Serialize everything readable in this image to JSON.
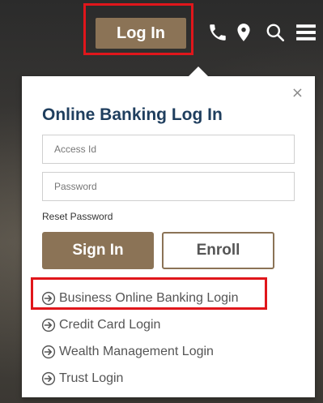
{
  "header": {
    "login_label": "Log In",
    "icons": [
      "phone-icon",
      "map-pin-icon",
      "search-icon",
      "menu-icon"
    ]
  },
  "login_panel": {
    "title": "Online Banking Log In",
    "close_symbol": "×",
    "access_id_placeholder": "Access Id",
    "password_placeholder": "Password",
    "reset_password_label": "Reset Password",
    "sign_in_label": "Sign In",
    "enroll_label": "Enroll",
    "links": [
      {
        "label": "Business Online Banking Login"
      },
      {
        "label": "Credit Card Login"
      },
      {
        "label": "Wealth Management Login"
      },
      {
        "label": "Trust Login"
      }
    ]
  },
  "colors": {
    "accent": "#8b7356",
    "title": "#1f3e5e",
    "highlight": "#e0161b"
  }
}
